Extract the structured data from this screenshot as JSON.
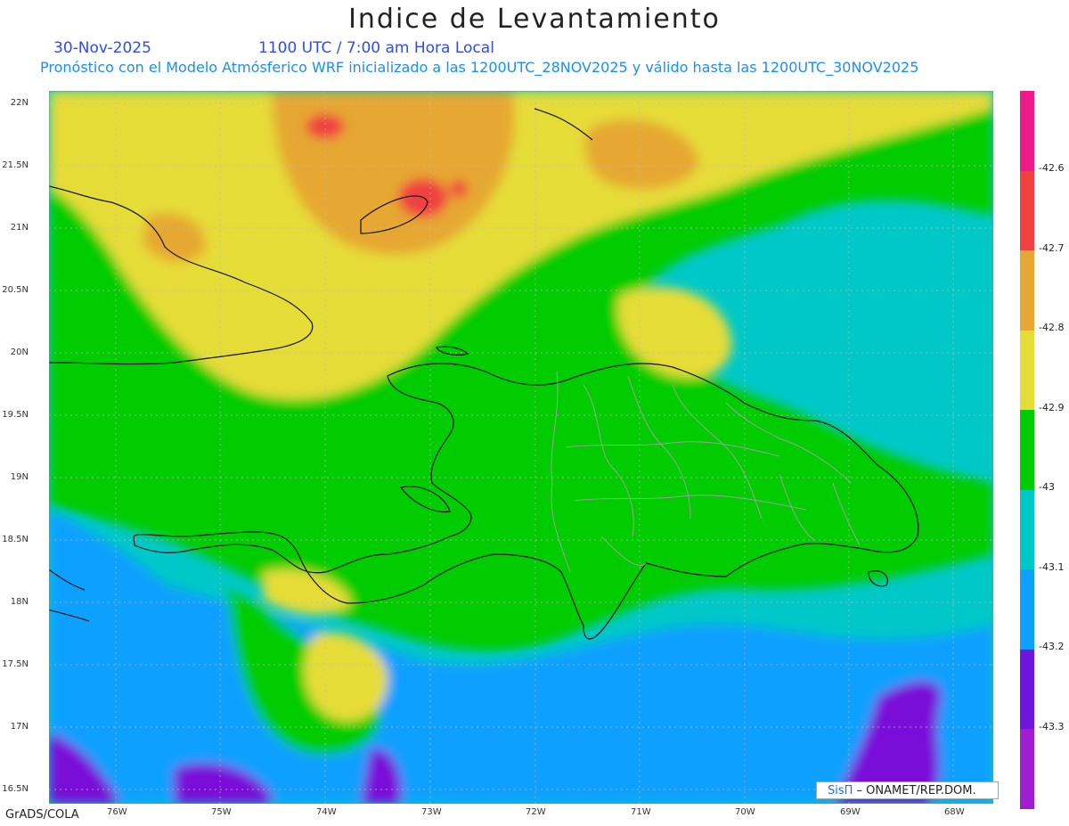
{
  "title": "Indice de Levantamiento",
  "date": "30-Nov-2025",
  "time": "1100 UTC / 7:00 am Hora Local",
  "subtitle": "Pronóstico con el Modelo Atmósferico WRF inicializado a las 1200UTC_28NOV2025 y válido hasta las  1200UTC_30NOV2025",
  "lat_labels": [
    "22N",
    "21.5N",
    "21N",
    "20.5N",
    "20N",
    "19.5N",
    "19N",
    "18.5N",
    "18N",
    "17.5N",
    "17N",
    "16.5N"
  ],
  "lon_labels": [
    "76W",
    "75W",
    "74W",
    "73W",
    "72W",
    "71W",
    "70W",
    "69W",
    "68W"
  ],
  "credit": "GrADS/COLA",
  "logo": {
    "sis": "SisΠ",
    "text": " – ONAMET/REP.DOM."
  },
  "colorbar": {
    "colors": [
      "#ee1a8a",
      "#f04040",
      "#e6a832",
      "#e6dc37",
      "#00cc00",
      "#00c8c8",
      "#0ea0ff",
      "#6e16dc",
      "#a01ed2"
    ],
    "labels": [
      "-42.6",
      "-42.7",
      "-42.8",
      "-42.9",
      "-43",
      "-43.1",
      "-43.2",
      "-43.3"
    ]
  },
  "field_colors": {
    "green": "#00cc00",
    "yellow": "#e6dc37",
    "orange": "#e6a832",
    "red": "#f04040",
    "cyan": "#00c8c8",
    "blue": "#0ea0ff",
    "purple": "#7a10d8"
  }
}
